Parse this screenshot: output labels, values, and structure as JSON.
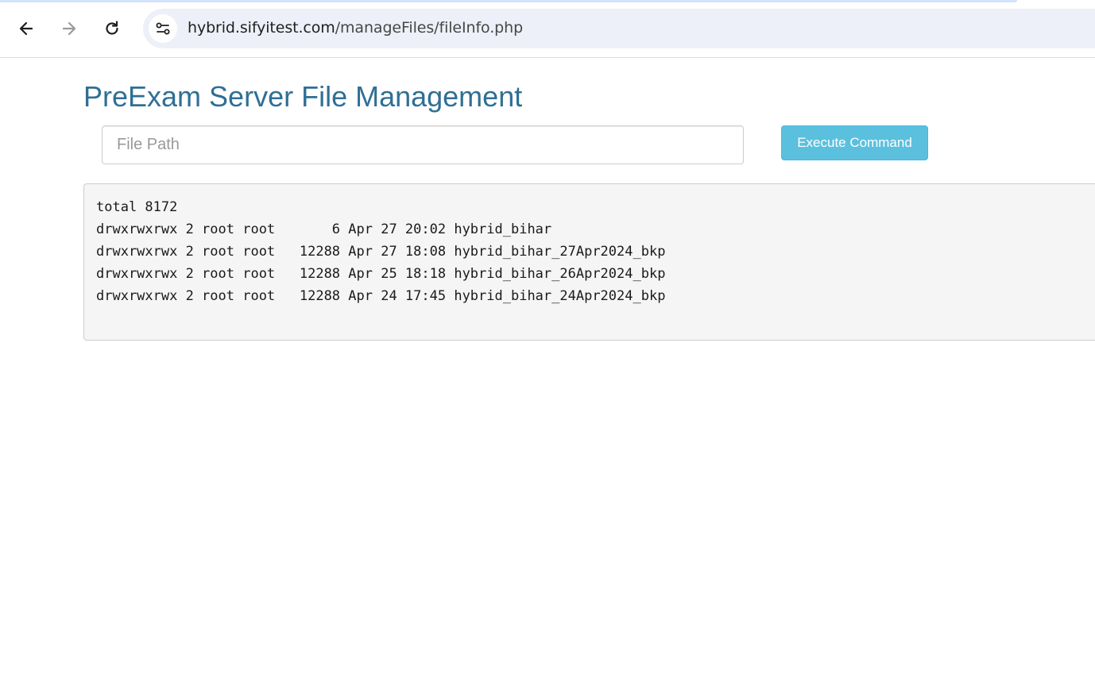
{
  "browser": {
    "url_host": "hybrid.sifyitest.com",
    "url_path": "/manageFiles/fileInfo.php",
    "back_icon": "back-arrow-icon",
    "forward_icon": "forward-arrow-icon",
    "reload_icon": "reload-icon",
    "site_info_icon": "site-settings-icon"
  },
  "page": {
    "title": "PreExam Server File Management",
    "file_path_placeholder": "File Path",
    "file_path_value": "",
    "execute_button_label": "Execute Command"
  },
  "output": {
    "lines": [
      "total 8172",
      "drwxrwxrwx 2 root root       6 Apr 27 20:02 hybrid_bihar",
      "drwxrwxrwx 2 root root   12288 Apr 27 18:08 hybrid_bihar_27Apr2024_bkp",
      "drwxrwxrwx 2 root root   12288 Apr 25 18:18 hybrid_bihar_26Apr2024_bkp",
      "drwxrwxrwx 2 root root   12288 Apr 24 17:45 hybrid_bihar_24Apr2024_bkp"
    ]
  },
  "colors": {
    "title": "#2f6f95",
    "button_bg": "#5bc0de",
    "output_bg": "#f5f5f5",
    "omnibox_bg": "#edf0f8"
  }
}
